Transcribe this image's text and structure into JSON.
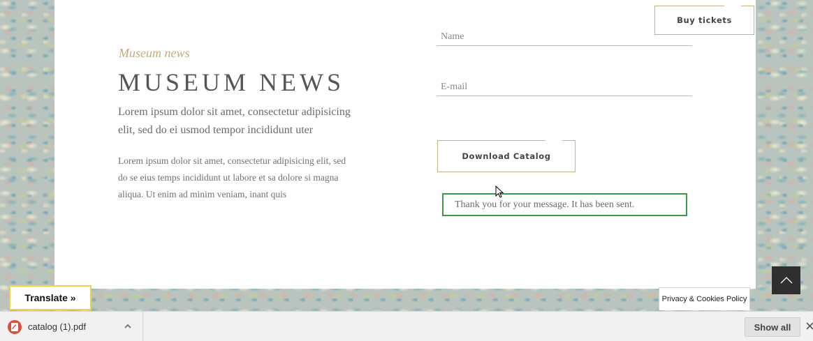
{
  "news": {
    "kicker": "Museum news",
    "title": "MUSEUM NEWS",
    "lead": "Lorem ipsum dolor sit amet, consectetur adipisicing elit, sed do ei usmod tempor incididunt uter",
    "body": "Lorem ipsum dolor sit amet, consectetur adipisicing elit, sed do se eius temps incididunt ut labore et sa dolore si magna aliqua. Ut enim ad minim veniam, inant quis"
  },
  "form": {
    "name_placeholder": "Name",
    "email_placeholder": "E-mail",
    "download_label": "Download Catalog",
    "success_message": "Thank you for your message. It has been sent."
  },
  "header": {
    "buy_tickets_label": "Buy tickets"
  },
  "overlays": {
    "translate_label": "Translate »",
    "privacy_label": "Privacy & Cookies Policy"
  },
  "download_shelf": {
    "file_name": "catalog (1).pdf",
    "show_all_label": "Show all"
  },
  "icons": {
    "pdf": "pdf-file-icon",
    "chevron_up": "chevron-up-icon",
    "close": "close-icon",
    "scroll_top": "chevron-up-icon"
  },
  "colors": {
    "accent_gold": "#c7a978",
    "success_green": "#3a9a4a",
    "translate_border": "#f0d247"
  }
}
